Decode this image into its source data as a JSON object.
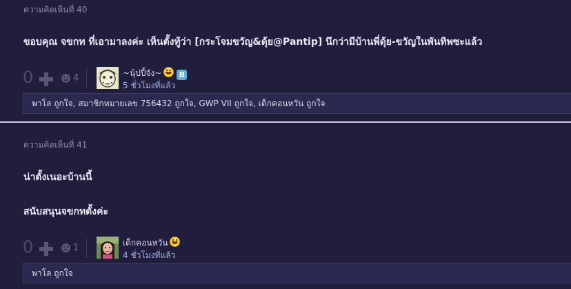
{
  "comments": [
    {
      "label": "ความคิดเห็นที่ 40",
      "body_lines": [
        "ขอบคุณ จขกท ที่เอามาลงค่ะ เห็นตั้งทู้ว่า [กระโจมขวัญ&ดุ้ย@Pantip] นึกว่ามีบ้านพี่ดุ้ย-ขวัญในพันทิพซะแล้ว"
      ],
      "score": "0",
      "emotion_count": "4",
      "author": "~นุ้ปปี้จัง~",
      "badge": "B",
      "time": "5 ชั่วโมงที่แล้ว",
      "likes": "พาโล ถูกใจ, สมาชิกหมายเลข 756432 ถูกใจ, GWP VII ถูกใจ, เด็กคอนหวัน ถูกใจ"
    },
    {
      "label": "ความคิดเห็นที่ 41",
      "body_lines": [
        "น่าตั้งเนอะบ้านนี้",
        "สนับสนุนจขกทตั้งค่ะ"
      ],
      "score": "0",
      "emotion_count": "1",
      "author": "เด็กคอนหวัน",
      "time": "4 ชั่วโมงที่แล้ว",
      "likes": "พาโล ถูกใจ"
    }
  ],
  "colors": {
    "background": "#211e3d",
    "likes_box": "#2c2950",
    "time_text": "#9fb5e8"
  },
  "icons": [
    "plus-icon",
    "emotion-icon",
    "smile-emoticon-icon",
    "bloggang-badge-icon"
  ]
}
